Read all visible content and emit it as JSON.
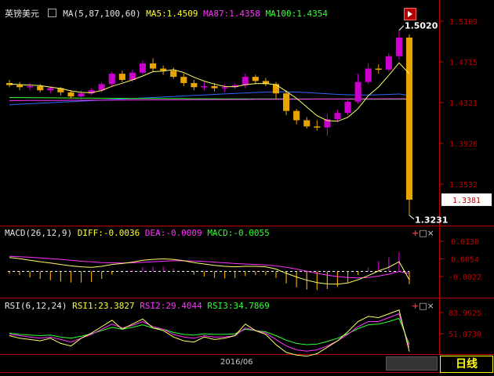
{
  "window": {
    "symbol": "英镑美元"
  },
  "main": {
    "ma_header": "MA(5,87,100,60)",
    "ma5": "MA5:1.4509",
    "ma87": "MA87:1.4358",
    "ma100": "MA100:1.4354",
    "price_ticks": [
      "1.5109",
      "1.4715",
      "1.4321",
      "1.3926",
      "1.3532"
    ],
    "current_price": "1.3381",
    "high_label": "1.5020",
    "low_label": "1.3231"
  },
  "macd": {
    "header": "MACD(26,12,9)",
    "diff": "DIFF:-0.0036",
    "dea": "DEA:-0.0009",
    "macd": "MACD:-0.0055",
    "ticks": [
      "0.0130",
      "0.0054",
      "-0.0022"
    ]
  },
  "rsi": {
    "header": "RSI(6,12,24)",
    "rsi1": "RSI1:23.3827",
    "rsi2": "RSI2:29.4044",
    "rsi3": "RSI3:34.7869",
    "ticks": [
      "83.9625",
      "51.0730"
    ]
  },
  "footer": {
    "date": "2016/06",
    "period_button": "日线"
  },
  "icons": {
    "settings": "settings-icon",
    "panel_add": "plus-icon",
    "panel_max": "square-icon",
    "panel_close": "close-icon"
  },
  "colors": {
    "up": "#cc00cc",
    "down": "#e8a400",
    "axis": "#c00000",
    "ma5": "#ffff66",
    "ma87": "#ff33ff",
    "ma100": "#33ff33",
    "ma60": "#3366ff"
  },
  "chart_data": [
    {
      "type": "candlestick",
      "title": "英镑美元",
      "ylim": [
        1.3231,
        1.5109
      ],
      "yticks": [
        1.5109,
        1.4715,
        1.4321,
        1.3926,
        1.3532
      ],
      "high": 1.502,
      "low": 1.3231,
      "last": 1.3381,
      "candles": [
        [
          1.451,
          1.449,
          1.454,
          1.447
        ],
        [
          1.449,
          1.447,
          1.452,
          1.444
        ],
        [
          1.447,
          1.448,
          1.451,
          1.444
        ],
        [
          1.448,
          1.444,
          1.45,
          1.442
        ],
        [
          1.444,
          1.446,
          1.448,
          1.441
        ],
        [
          1.446,
          1.442,
          1.447,
          1.439
        ],
        [
          1.442,
          1.438,
          1.444,
          1.436
        ],
        [
          1.438,
          1.441,
          1.444,
          1.435
        ],
        [
          1.441,
          1.444,
          1.446,
          1.439
        ],
        [
          1.444,
          1.45,
          1.452,
          1.442
        ],
        [
          1.45,
          1.46,
          1.462,
          1.447
        ],
        [
          1.46,
          1.454,
          1.463,
          1.452
        ],
        [
          1.454,
          1.461,
          1.464,
          1.452
        ],
        [
          1.461,
          1.47,
          1.473,
          1.459
        ],
        [
          1.47,
          1.465,
          1.475,
          1.462
        ],
        [
          1.465,
          1.463,
          1.468,
          1.459
        ],
        [
          1.463,
          1.457,
          1.466,
          1.455
        ],
        [
          1.457,
          1.451,
          1.46,
          1.448
        ],
        [
          1.451,
          1.447,
          1.454,
          1.444
        ],
        [
          1.447,
          1.448,
          1.452,
          1.444
        ],
        [
          1.448,
          1.446,
          1.451,
          1.443
        ],
        [
          1.446,
          1.447,
          1.45,
          1.442
        ],
        [
          1.447,
          1.449,
          1.451,
          1.445
        ],
        [
          1.449,
          1.457,
          1.46,
          1.446
        ],
        [
          1.457,
          1.453,
          1.459,
          1.45
        ],
        [
          1.453,
          1.45,
          1.456,
          1.448
        ],
        [
          1.45,
          1.441,
          1.452,
          1.436
        ],
        [
          1.441,
          1.424,
          1.444,
          1.42
        ],
        [
          1.424,
          1.415,
          1.426,
          1.411
        ],
        [
          1.415,
          1.409,
          1.418,
          1.407
        ],
        [
          1.409,
          1.408,
          1.415,
          1.405
        ],
        [
          1.408,
          1.416,
          1.421,
          1.4
        ],
        [
          1.416,
          1.422,
          1.425,
          1.413
        ],
        [
          1.422,
          1.433,
          1.436,
          1.42
        ],
        [
          1.433,
          1.452,
          1.46,
          1.431
        ],
        [
          1.452,
          1.465,
          1.47,
          1.45
        ],
        [
          1.465,
          1.464,
          1.469,
          1.46
        ],
        [
          1.464,
          1.477,
          1.48,
          1.462
        ],
        [
          1.477,
          1.495,
          1.502,
          1.474
        ],
        [
          1.495,
          1.3381,
          1.498,
          1.3231
        ]
      ],
      "ma5": [
        1.45,
        1.4495,
        1.449,
        1.4485,
        1.447,
        1.4458,
        1.4434,
        1.442,
        1.4416,
        1.4438,
        1.4478,
        1.4508,
        1.454,
        1.4578,
        1.462,
        1.4626,
        1.464,
        1.4612,
        1.4566,
        1.4528,
        1.45,
        1.4476,
        1.4474,
        1.4494,
        1.4504,
        1.4506,
        1.4494,
        1.443,
        1.4362,
        1.4278,
        1.4194,
        1.4146,
        1.414,
        1.4178,
        1.4262,
        1.4388,
        1.4472,
        1.4584,
        1.4706,
        1.46
      ],
      "ma87": [
        1.434,
        1.434,
        1.4341,
        1.4341,
        1.4342,
        1.4342,
        1.4343,
        1.4343,
        1.4344,
        1.4344,
        1.4345,
        1.4345,
        1.4346,
        1.4346,
        1.4347,
        1.4347,
        1.4348,
        1.4348,
        1.4349,
        1.4349,
        1.435,
        1.435,
        1.4351,
        1.4351,
        1.4352,
        1.4352,
        1.4353,
        1.4353,
        1.4354,
        1.4354,
        1.4355,
        1.4355,
        1.4355,
        1.4356,
        1.4356,
        1.4357,
        1.4357,
        1.4358,
        1.4358,
        1.4358
      ],
      "ma100": [
        1.437,
        1.4369,
        1.4368,
        1.4368,
        1.4367,
        1.4366,
        1.4365,
        1.4364,
        1.4364,
        1.4363,
        1.4362,
        1.4362,
        1.4361,
        1.4361,
        1.436,
        1.436,
        1.4359,
        1.4359,
        1.4358,
        1.4358,
        1.4358,
        1.4357,
        1.4357,
        1.4357,
        1.4356,
        1.4356,
        1.4356,
        1.4356,
        1.4355,
        1.4355,
        1.4355,
        1.4355,
        1.4355,
        1.4354,
        1.4354,
        1.4354,
        1.4354,
        1.4354,
        1.4354,
        1.4354
      ],
      "ma60": [
        1.43,
        1.4305,
        1.431,
        1.4315,
        1.432,
        1.4325,
        1.433,
        1.4335,
        1.434,
        1.4345,
        1.435,
        1.4355,
        1.436,
        1.4365,
        1.437,
        1.4375,
        1.438,
        1.4385,
        1.439,
        1.4395,
        1.44,
        1.4405,
        1.441,
        1.4414,
        1.4418,
        1.4422,
        1.4424,
        1.4424,
        1.4422,
        1.4418,
        1.4412,
        1.4406,
        1.44,
        1.4396,
        1.4394,
        1.4394,
        1.4396,
        1.44,
        1.4404,
        1.439
      ]
    },
    {
      "type": "macd",
      "yticks": [
        0.013,
        0.0054,
        -0.0022
      ],
      "ylim": [
        -0.006,
        0.016
      ],
      "diff": [
        0.006,
        0.0055,
        0.0048,
        0.0042,
        0.0036,
        0.003,
        0.0024,
        0.002,
        0.0018,
        0.0022,
        0.003,
        0.0034,
        0.004,
        0.0048,
        0.0052,
        0.0054,
        0.0052,
        0.0046,
        0.0038,
        0.0032,
        0.0026,
        0.0022,
        0.002,
        0.0022,
        0.0022,
        0.002,
        0.001,
        -0.0008,
        -0.0024,
        -0.0038,
        -0.0048,
        -0.0054,
        -0.0055,
        -0.005,
        -0.0036,
        -0.0018,
        0.0002,
        0.0018,
        0.0042,
        -0.0036
      ],
      "dea": [
        0.0065,
        0.0063,
        0.0061,
        0.0058,
        0.0055,
        0.0052,
        0.0048,
        0.0044,
        0.0041,
        0.0038,
        0.0037,
        0.0036,
        0.0037,
        0.0039,
        0.0042,
        0.0044,
        0.0046,
        0.0046,
        0.0045,
        0.0043,
        0.004,
        0.0037,
        0.0034,
        0.0032,
        0.003,
        0.0028,
        0.0024,
        0.0018,
        0.001,
        0.0001,
        -0.0008,
        -0.0016,
        -0.0022,
        -0.0026,
        -0.0028,
        -0.0026,
        -0.002,
        -0.0012,
        0.0,
        -0.0009
      ],
      "macd": [
        -0.001,
        -0.0016,
        -0.0026,
        -0.0032,
        -0.0038,
        -0.0044,
        -0.0048,
        -0.0048,
        -0.0046,
        -0.0032,
        -0.0014,
        -0.0004,
        0.0006,
        0.0018,
        0.002,
        0.002,
        0.0012,
        0.0,
        -0.0014,
        -0.0022,
        -0.0028,
        -0.003,
        -0.0028,
        -0.002,
        -0.0016,
        -0.0016,
        -0.0028,
        -0.0052,
        -0.0068,
        -0.0078,
        -0.008,
        -0.0076,
        -0.0066,
        -0.0048,
        -0.0016,
        0.0016,
        0.0044,
        0.006,
        0.0084,
        -0.0055
      ]
    },
    {
      "type": "rsi",
      "yticks": [
        83.9625,
        51.073
      ],
      "ylim": [
        15,
        95
      ],
      "rsi1": [
        48,
        44,
        42,
        40,
        44,
        36,
        32,
        44,
        52,
        62,
        72,
        58,
        66,
        74,
        60,
        56,
        46,
        40,
        38,
        46,
        42,
        44,
        48,
        66,
        56,
        50,
        34,
        22,
        18,
        16,
        20,
        30,
        40,
        54,
        70,
        78,
        76,
        82,
        88,
        23.38
      ],
      "rsi2": [
        50,
        48,
        46,
        44,
        46,
        42,
        38,
        44,
        50,
        58,
        66,
        60,
        64,
        70,
        62,
        58,
        50,
        46,
        44,
        48,
        46,
        46,
        48,
        60,
        56,
        52,
        42,
        32,
        26,
        24,
        26,
        32,
        40,
        50,
        62,
        70,
        70,
        76,
        82,
        29.4
      ],
      "rsi3": [
        52,
        50,
        49,
        48,
        49,
        46,
        44,
        47,
        51,
        56,
        61,
        58,
        61,
        65,
        60,
        58,
        53,
        50,
        49,
        51,
        50,
        50,
        51,
        58,
        56,
        54,
        48,
        41,
        36,
        34,
        35,
        39,
        44,
        51,
        59,
        65,
        66,
        70,
        75,
        34.79
      ]
    }
  ]
}
